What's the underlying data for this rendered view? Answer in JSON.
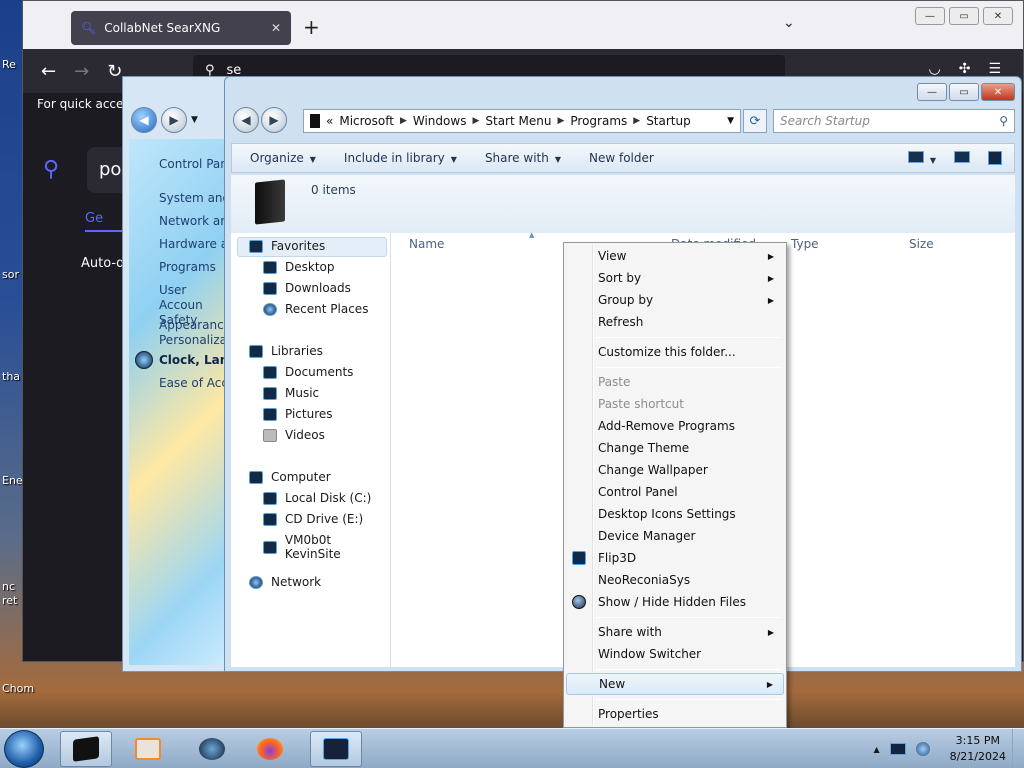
{
  "desktop": {
    "icon_labels": [
      "Re",
      "sor",
      "tha",
      "Ene",
      "nc ret",
      "Chom"
    ]
  },
  "browser": {
    "tab_title": "CollabNet SearXNG",
    "tab_close": "✕",
    "new_tab": "+",
    "tabs_dropdown": "⌄",
    "url_text": "se",
    "quick_access": "For quick access",
    "search_query": "por",
    "tab_general": "Ge",
    "auto_text": "Auto-de",
    "nav": {
      "back": "←",
      "forward": "→",
      "reload": "↻"
    },
    "window_buttons": [
      "—",
      "▭",
      "✕"
    ]
  },
  "control_panel": {
    "items": [
      "Control Pane",
      "System and",
      "Network and",
      "Hardware ar",
      "Programs",
      "User Accoun Safety",
      "Appearance Personalizati",
      "Clock, Langu",
      "Ease of Acce"
    ]
  },
  "explorer": {
    "window_buttons": [
      "—",
      "▭",
      "✕"
    ],
    "address": {
      "root": "«",
      "crumbs": [
        "Microsoft",
        "Windows",
        "Start Menu",
        "Programs",
        "Startup"
      ]
    },
    "search_placeholder": "Search Startup",
    "toolbar": {
      "organize": "Organize",
      "include_in_library": "Include in library",
      "share_with": "Share with",
      "new_folder": "New folder"
    },
    "items_count": "0 items",
    "nav": {
      "favorites": "Favorites",
      "desktop": "Desktop",
      "downloads": "Downloads",
      "recent_places": "Recent Places",
      "libraries": "Libraries",
      "documents": "Documents",
      "music": "Music",
      "pictures": "Pictures",
      "videos": "Videos",
      "computer": "Computer",
      "local_disk": "Local Disk (C:)",
      "cd_drive": "CD Drive (E:)",
      "vmobot": "VM0b0t KevinSite",
      "network": "Network"
    },
    "columns": {
      "name": "Name",
      "date_modified": "Date modified",
      "type": "Type",
      "size": "Size"
    }
  },
  "context_menu": {
    "view": "View",
    "sort_by": "Sort by",
    "group_by": "Group by",
    "refresh": "Refresh",
    "customize": "Customize this folder...",
    "paste": "Paste",
    "paste_shortcut": "Paste shortcut",
    "add_remove": "Add-Remove Programs",
    "change_theme": "Change Theme",
    "change_wallpaper": "Change Wallpaper",
    "control_panel": "Control Panel",
    "desktop_icons": "Desktop Icons Settings",
    "device_manager": "Device Manager",
    "flip3d": "Flip3D",
    "neoreconia": "NeoReconiaSys",
    "show_hide": "Show / Hide Hidden Files",
    "share_with": "Share with",
    "window_switcher": "Window Switcher",
    "new": "New",
    "properties": "Properties"
  },
  "taskbar": {
    "time": "3:15 PM",
    "date": "8/21/2024",
    "tray_arrow": "▲"
  },
  "colors": {
    "accent": "#5b67ff",
    "menu_highlight": "#dbeaf9",
    "taskbar": "#a6bfd8"
  }
}
